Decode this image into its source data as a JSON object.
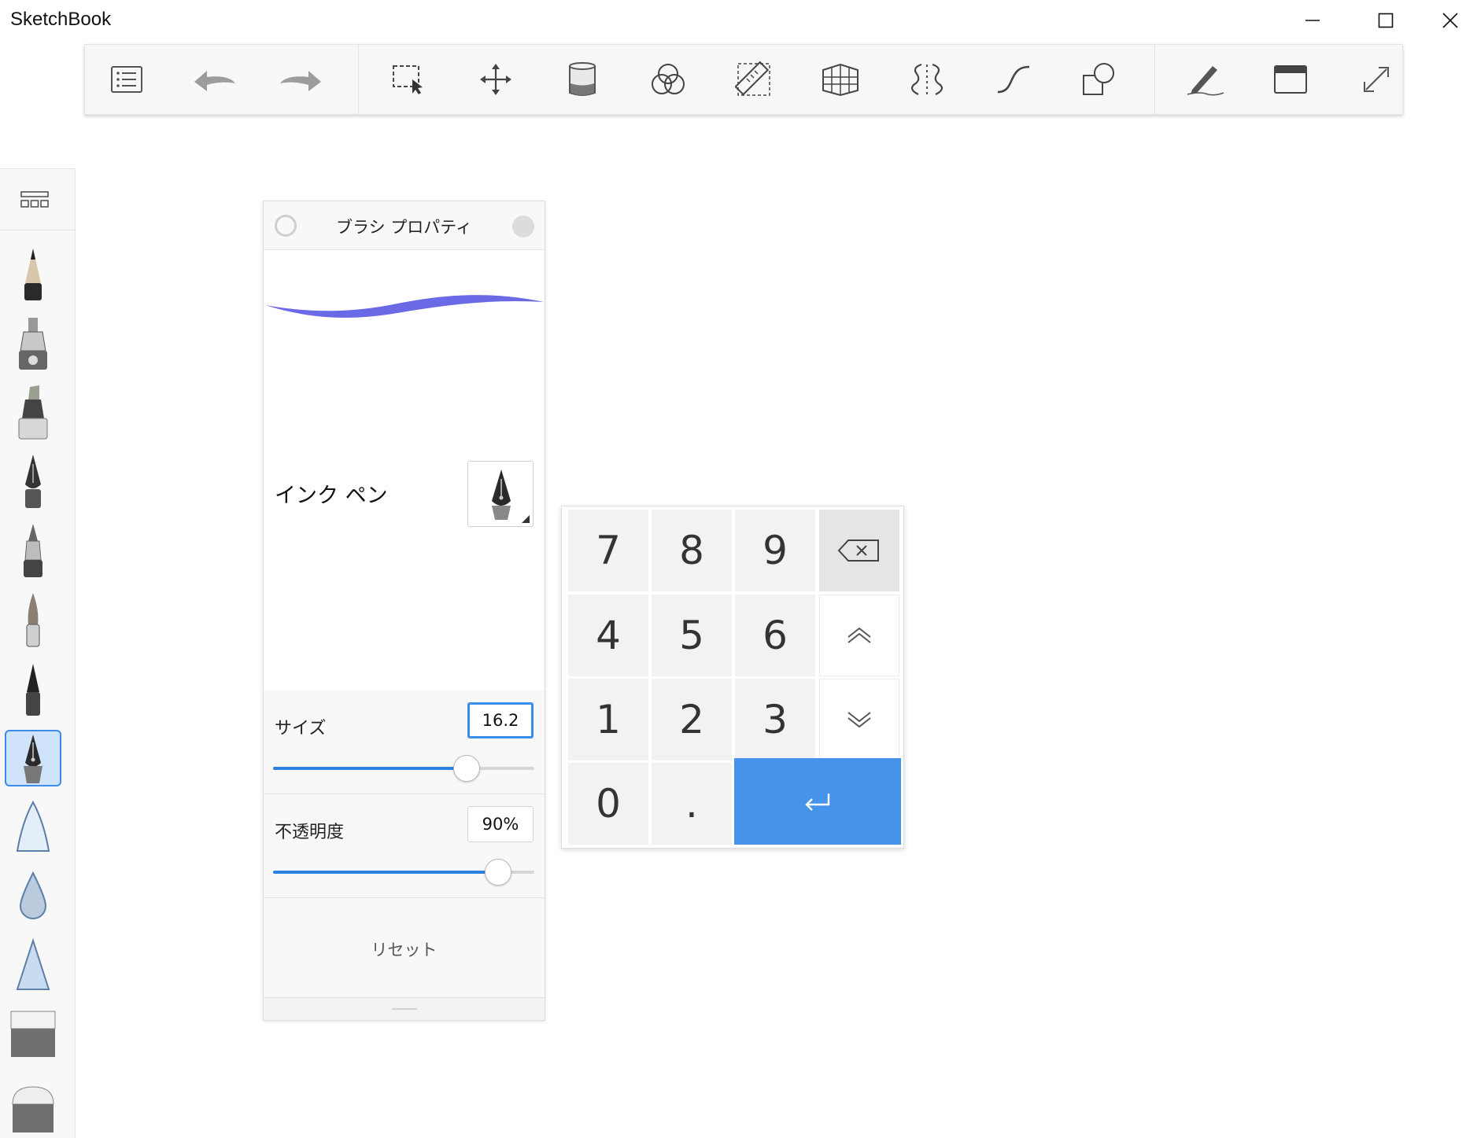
{
  "window": {
    "title": "SketchBook",
    "controls": [
      "minimize",
      "maximize",
      "close"
    ]
  },
  "toolbar": {
    "buttons": [
      {
        "name": "list-icon"
      },
      {
        "name": "undo-icon"
      },
      {
        "name": "redo-icon"
      },
      {
        "name": "selection-icon"
      },
      {
        "name": "transform-icon"
      },
      {
        "name": "fill-bucket-icon"
      },
      {
        "name": "color-circles-icon"
      },
      {
        "name": "ruler-icon"
      },
      {
        "name": "perspective-grid-icon"
      },
      {
        "name": "symmetry-icon"
      },
      {
        "name": "curve-icon"
      },
      {
        "name": "shapes-icon"
      },
      {
        "name": "pen-stroke-icon"
      },
      {
        "name": "window-icon"
      },
      {
        "name": "fullscreen-icon"
      }
    ]
  },
  "palette": {
    "library_icon": "brush-library-icon",
    "brushes": [
      {
        "name": "pencil-brush"
      },
      {
        "name": "airbrush-brush"
      },
      {
        "name": "marker-brush"
      },
      {
        "name": "fountain-pen-brush"
      },
      {
        "name": "ballpoint-pen-brush"
      },
      {
        "name": "paintbrush-brush"
      },
      {
        "name": "felt-pen-brush"
      },
      {
        "name": "ink-pen-brush",
        "selected": true
      },
      {
        "name": "soft-cone-brush"
      },
      {
        "name": "water-drop-brush"
      },
      {
        "name": "hard-cone-brush"
      },
      {
        "name": "soft-eraser-brush"
      },
      {
        "name": "hard-eraser-brush"
      }
    ]
  },
  "brush_properties": {
    "title": "ブラシ プロパティ",
    "brush_name": "インク ペン",
    "stroke_color": "#6a6ae6",
    "size": {
      "label": "サイズ",
      "value": "16.2",
      "fraction": 0.74
    },
    "opacity": {
      "label": "不透明度",
      "value": "90%",
      "fraction": 0.86
    },
    "reset_label": "リセット"
  },
  "keypad": {
    "keys": {
      "k7": "7",
      "k8": "8",
      "k9": "9",
      "k4": "4",
      "k5": "5",
      "k6": "6",
      "k1": "1",
      "k2": "2",
      "k3": "3",
      "k0": "0",
      "kdot": "."
    },
    "backspace_icon": "backspace-icon",
    "up_icon": "chevron-up-icon",
    "down_icon": "chevron-down-icon",
    "enter_icon": "enter-icon",
    "accent": "#4593ea"
  }
}
